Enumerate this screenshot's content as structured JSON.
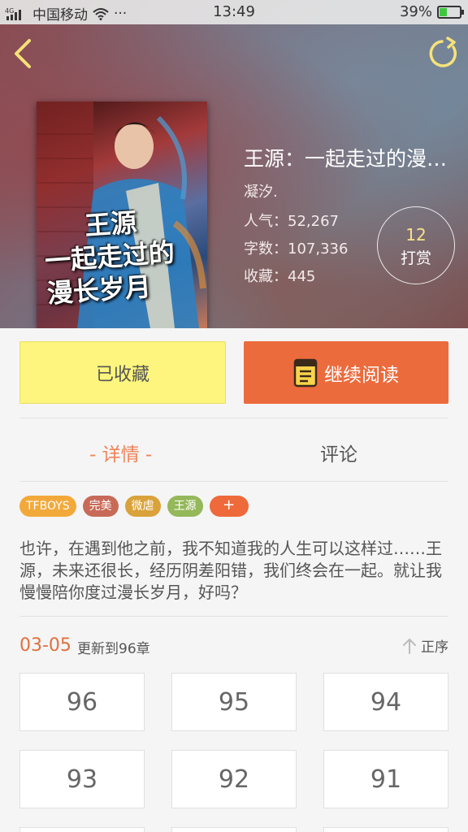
{
  "statusbar": {
    "carrier": "中国移动",
    "signal_label": "4G",
    "dots": "···",
    "time": "13:49",
    "battery_percent_text": "39%",
    "battery_level": 0.39
  },
  "icons": {
    "back": "chevron-left-icon",
    "refresh": "refresh-icon",
    "book": "book-icon",
    "sort": "arrow-up-icon"
  },
  "cover": {
    "title_line1": "王源",
    "title_line2": "一起走过的",
    "title_line3": "漫长岁月"
  },
  "book": {
    "title": "王源：一起走过的漫长岁月",
    "author": "凝汐.",
    "popularity": "人气：52,267",
    "word_count": "字数：107,336",
    "favorites": "收藏：445"
  },
  "reward": {
    "count": "12",
    "label": "打赏"
  },
  "actions": {
    "favorited_label": "已收藏",
    "continue_label": "继续阅读"
  },
  "tabs": {
    "detail": "- 详情 -",
    "comment": "评论"
  },
  "tags": [
    {
      "label": "TFBOYS",
      "color": "#f3a93a"
    },
    {
      "label": "完美",
      "color": "#c86a58"
    },
    {
      "label": "微虐",
      "color": "#d9a23a"
    },
    {
      "label": "王源",
      "color": "#94b85a"
    },
    {
      "label": "+",
      "color": "#ee6a3a"
    }
  ],
  "description": "也许，在遇到他之前，我不知道我的人生可以这样过……王源，未来还很长，经历阴差阳错，我们终会在一起。就让我慢慢陪你度过漫长岁月，好吗？",
  "update": {
    "date": "03-05",
    "text": "更新到96章",
    "sort_label": "正序"
  },
  "chapters": [
    "96",
    "95",
    "94",
    "93",
    "92",
    "91"
  ],
  "colors": {
    "accent_orange": "#ec6b3d",
    "favorite_yellow": "#fdf57d",
    "tab_active": "#f0845a"
  }
}
